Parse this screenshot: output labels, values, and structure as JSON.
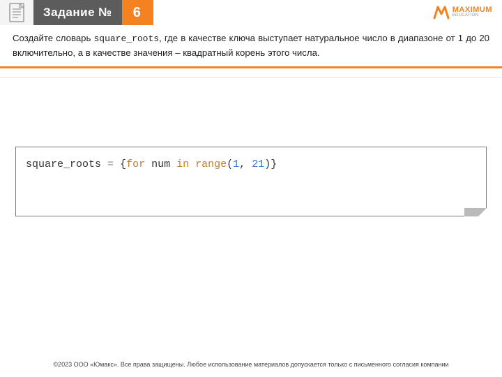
{
  "header": {
    "title": "Задание №",
    "number": "6",
    "logo_text": "MAXIMUM",
    "logo_sub": "EDUCATION"
  },
  "task": {
    "part1": "Создайте словарь ",
    "code_name": "square_roots",
    "part2": ", где в качестве ключа выступает натуральное число в диапазоне от 1 до 20 включительно, а в качестве значения – квадратный корень этого числа."
  },
  "code": {
    "t1": "square_roots ",
    "t2": "=",
    "t3": " {",
    "t4": "for",
    "t5": " num ",
    "t6": "in",
    "t7": " ",
    "t8": "range",
    "t9": "(",
    "t10": "1",
    "t11": ", ",
    "t12": "21",
    "t13": ")}"
  },
  "footer": {
    "copyright": "©2023 ООО «Юмакс». Все права защищены. Любое использование материалов допускается только с письменного согласия компании"
  }
}
